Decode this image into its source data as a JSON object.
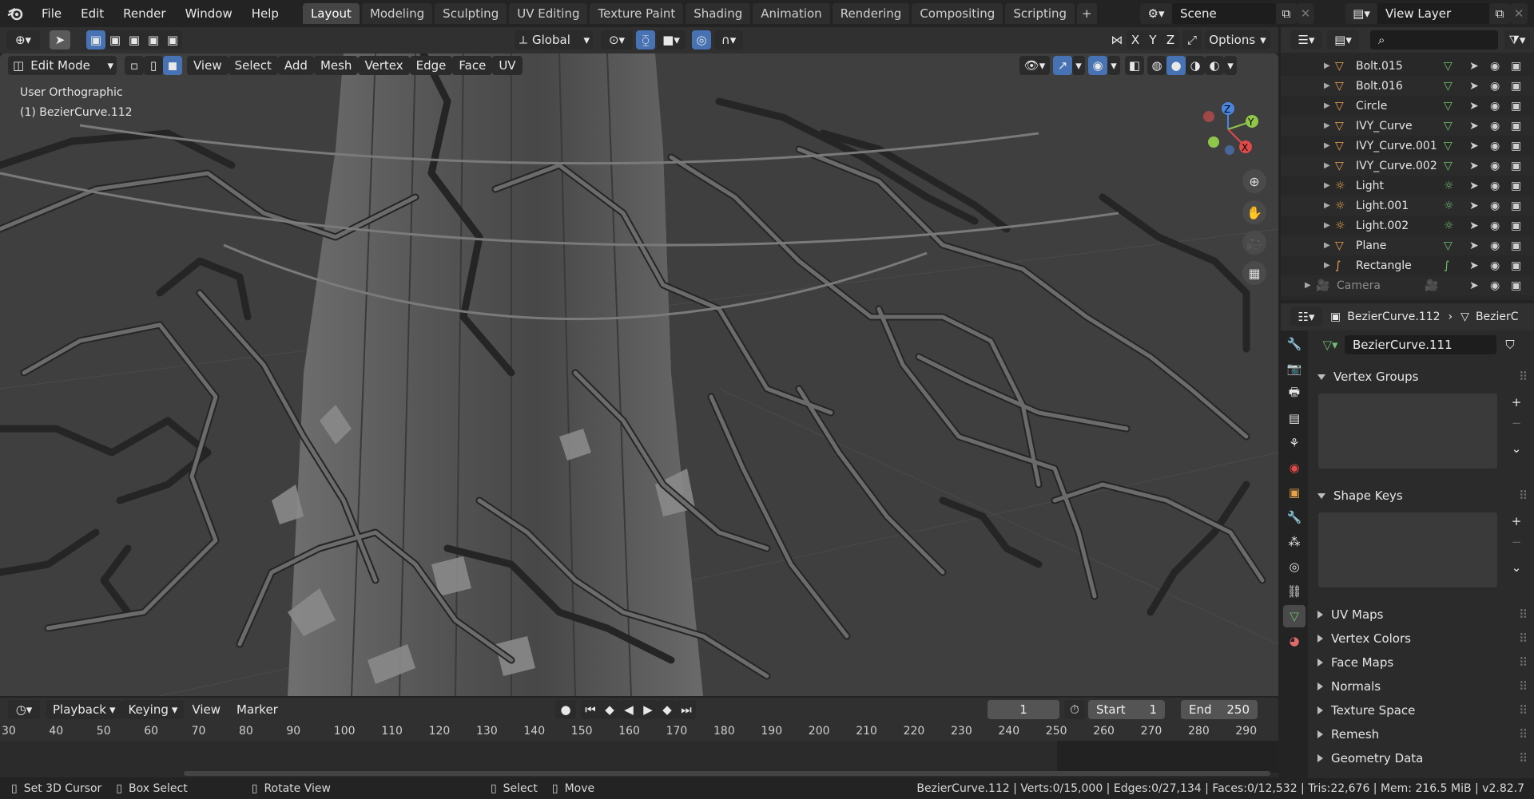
{
  "menu": [
    "File",
    "Edit",
    "Render",
    "Window",
    "Help"
  ],
  "workspaces": [
    {
      "label": "Layout",
      "active": true
    },
    {
      "label": "Modeling"
    },
    {
      "label": "Sculpting"
    },
    {
      "label": "UV Editing"
    },
    {
      "label": "Texture Paint"
    },
    {
      "label": "Shading"
    },
    {
      "label": "Animation"
    },
    {
      "label": "Rendering"
    },
    {
      "label": "Compositing"
    },
    {
      "label": "Scripting"
    }
  ],
  "add_workspace": "+",
  "scene": {
    "label": "Scene"
  },
  "view_layer": {
    "label": "View Layer"
  },
  "viewport_header": {
    "orientation": "Global",
    "axes": [
      "X",
      "Y",
      "Z"
    ],
    "options": "Options",
    "mode": "Edit Mode",
    "menus": [
      "View",
      "Select",
      "Add",
      "Mesh",
      "Vertex",
      "Edge",
      "Face",
      "UV"
    ]
  },
  "viewport_info": {
    "view_name": "User Orthographic",
    "object_name": "(1) BezierCurve.112"
  },
  "gizmo": {
    "z": "Z",
    "y": "Y",
    "x": "X"
  },
  "outliner": {
    "rows": [
      {
        "name": "Bolt.015",
        "type": "mesh"
      },
      {
        "name": "Bolt.016",
        "type": "mesh"
      },
      {
        "name": "Circle",
        "type": "mesh"
      },
      {
        "name": "IVY_Curve",
        "type": "mesh"
      },
      {
        "name": "IVY_Curve.001",
        "type": "mesh"
      },
      {
        "name": "IVY_Curve.002",
        "type": "mesh"
      },
      {
        "name": "Light",
        "type": "light"
      },
      {
        "name": "Light.001",
        "type": "light"
      },
      {
        "name": "Light.002",
        "type": "light"
      },
      {
        "name": "Plane",
        "type": "mesh"
      },
      {
        "name": "Rectangle",
        "type": "curve"
      },
      {
        "name": "Camera",
        "type": "camera",
        "dim": true
      }
    ]
  },
  "properties": {
    "breadcrumb_object": "BezierCurve.112",
    "breadcrumb_data": "BezierC",
    "data_name": "BezierCurve.111",
    "panels": [
      {
        "label": "Vertex Groups",
        "open": true
      },
      {
        "label": "Shape Keys",
        "open": true
      },
      {
        "label": "UV Maps",
        "open": false
      },
      {
        "label": "Vertex Colors",
        "open": false
      },
      {
        "label": "Face Maps",
        "open": false
      },
      {
        "label": "Normals",
        "open": false
      },
      {
        "label": "Texture Space",
        "open": false
      },
      {
        "label": "Remesh",
        "open": false
      },
      {
        "label": "Geometry Data",
        "open": false
      }
    ]
  },
  "timeline": {
    "menus": [
      "Playback",
      "Keying",
      "View",
      "Marker"
    ],
    "current_frame": "1",
    "start_label": "Start",
    "start": "1",
    "end_label": "End",
    "end": "250",
    "ticks": [
      "30",
      "40",
      "50",
      "60",
      "70",
      "80",
      "90",
      "100",
      "110",
      "120",
      "130",
      "140",
      "150",
      "160",
      "170",
      "180",
      "190",
      "200",
      "210",
      "220",
      "230",
      "240",
      "250",
      "260",
      "270",
      "280",
      "290"
    ]
  },
  "statusbar": {
    "hints": [
      "Set 3D Cursor",
      "Box Select",
      "Rotate View",
      "Select",
      "Move"
    ],
    "stats": "BezierCurve.112 | Verts:0/15,000 | Edges:0/27,134 | Faces:0/12,532 | Tris:22,676 | Mem: 216.5 MiB | v2.82.7"
  },
  "colors": {
    "accent": "#4772b3",
    "mesh_icon": "#e8a34a",
    "data_green": "#6fbf6f",
    "x_axis": "#e04a4a",
    "y_axis": "#8fc64a",
    "z_axis": "#4a86e0"
  }
}
